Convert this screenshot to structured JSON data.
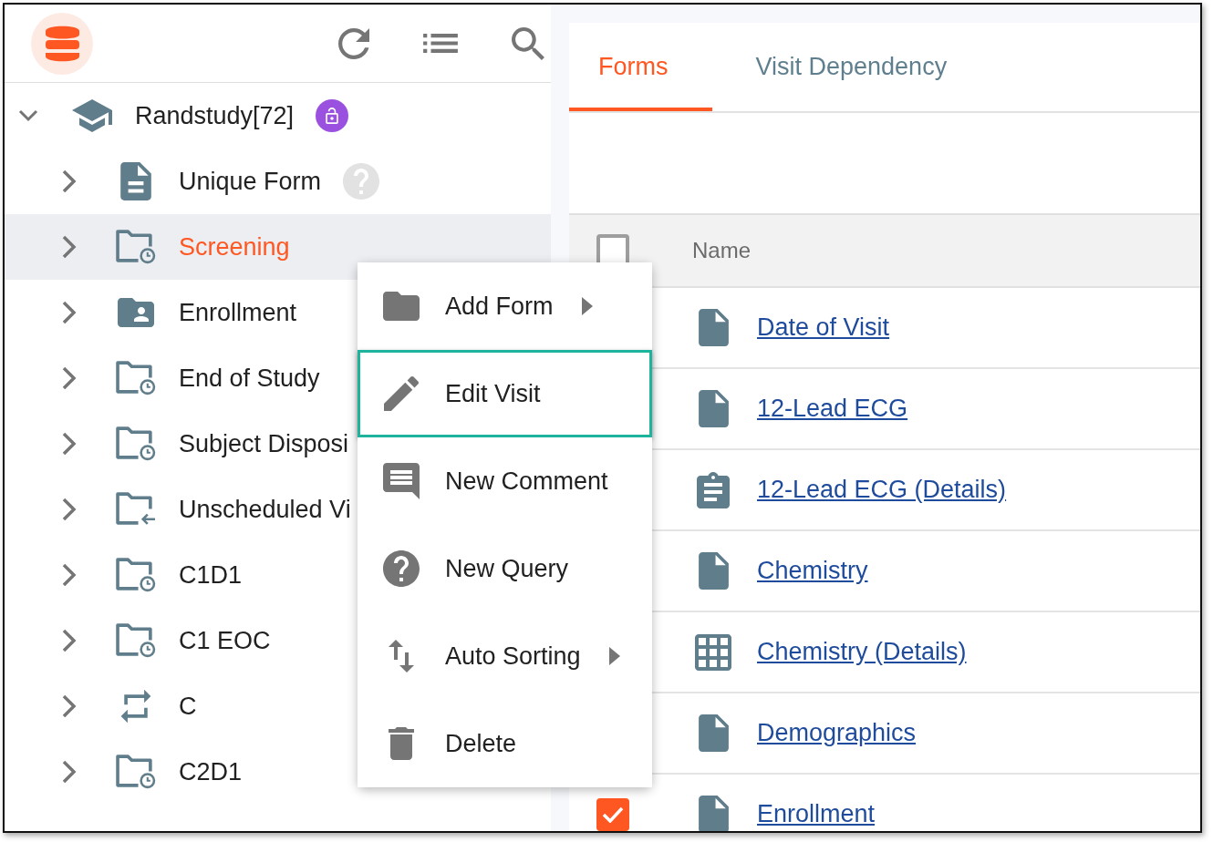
{
  "sidebar": {
    "tree": [
      {
        "label": "Randstudy[72]",
        "kind": "study",
        "expanded": true,
        "selected": false,
        "locked": false,
        "children": [
          {
            "label": "Unique Form",
            "kind": "form",
            "expanded": false,
            "selected": false,
            "has_query": true
          },
          {
            "label": "Screening",
            "kind": "visit",
            "expanded": false,
            "selected": true,
            "has_query": false
          },
          {
            "label": "Enrollment",
            "kind": "enrollment",
            "expanded": false,
            "selected": false,
            "has_query": false
          },
          {
            "label": "End of Study",
            "kind": "visit",
            "expanded": false,
            "selected": false,
            "has_query": false
          },
          {
            "label": "Subject Disposi",
            "kind": "visit",
            "expanded": false,
            "selected": false,
            "has_query": false
          },
          {
            "label": "Unscheduled Vi",
            "kind": "unscheduled",
            "expanded": false,
            "selected": false,
            "has_query": false
          },
          {
            "label": "C1D1",
            "kind": "visit",
            "expanded": false,
            "selected": false,
            "has_query": false
          },
          {
            "label": "C1 EOC",
            "kind": "visit",
            "expanded": false,
            "selected": false,
            "has_query": false
          },
          {
            "label": "C",
            "kind": "cycle",
            "expanded": false,
            "selected": false,
            "has_query": false
          },
          {
            "label": "C2D1",
            "kind": "visit",
            "expanded": false,
            "selected": false,
            "has_query": false
          }
        ]
      }
    ]
  },
  "main": {
    "tabs": [
      {
        "label": "Forms",
        "selected": true
      },
      {
        "label": "Visit Dependency",
        "selected": false
      }
    ],
    "table": {
      "select_all": {
        "checked": false
      },
      "columns": [
        "Name"
      ],
      "rows": [
        {
          "name": "Date of Visit",
          "kind": "form"
        },
        {
          "name": "12-Lead ECG",
          "kind": "form"
        },
        {
          "name": "12-Lead ECG (Details)",
          "kind": "details"
        },
        {
          "name": "Chemistry",
          "kind": "form"
        },
        {
          "name": "Chemistry (Details)",
          "kind": "grid"
        },
        {
          "name": "Demographics",
          "kind": "form"
        },
        {
          "name": "Enrollment",
          "kind": "form",
          "checked": true
        }
      ]
    }
  },
  "context_menu": {
    "items": [
      {
        "label": "Add Form",
        "kind": "add",
        "submenu": true,
        "highlighted": false
      },
      {
        "label": "Edit Visit",
        "kind": "edit",
        "submenu": false,
        "highlighted": true
      },
      {
        "label": "New Comment",
        "kind": "comment",
        "submenu": false,
        "highlighted": false
      },
      {
        "label": "New Query",
        "kind": "query",
        "submenu": false,
        "highlighted": false
      },
      {
        "label": "Auto Sorting",
        "kind": "sort",
        "submenu": true,
        "highlighted": false
      },
      {
        "label": "Delete",
        "kind": "delete",
        "submenu": false,
        "highlighted": false
      }
    ]
  }
}
